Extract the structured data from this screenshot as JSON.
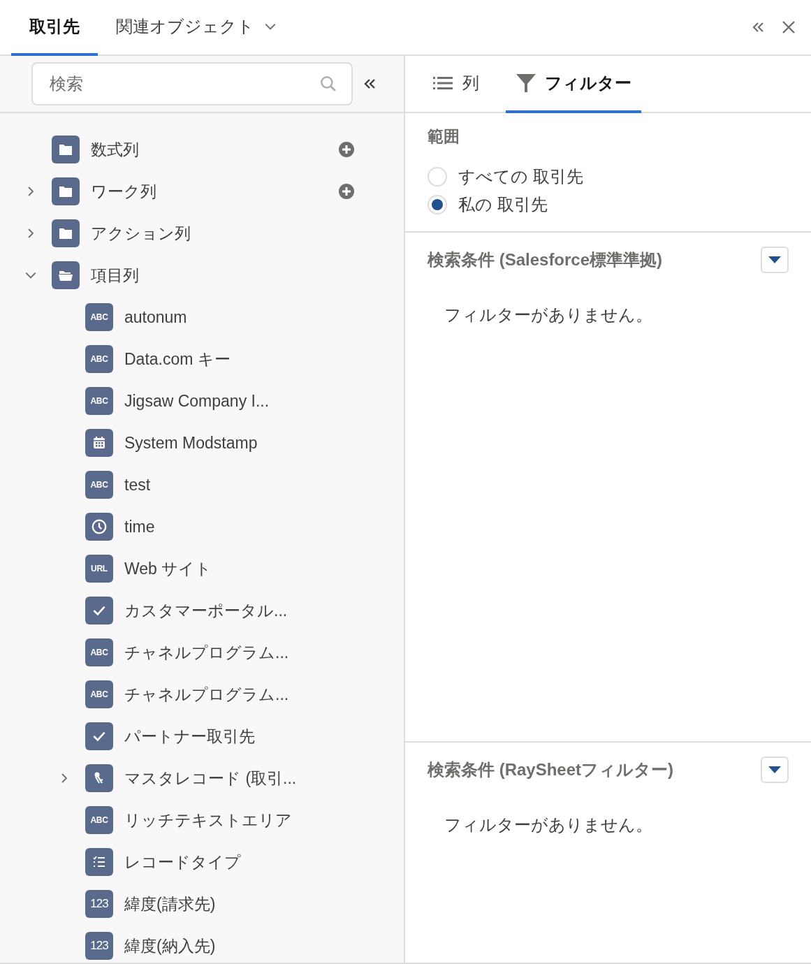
{
  "header": {
    "tabs": [
      {
        "label": "取引先",
        "selected": true,
        "dropdown": false
      },
      {
        "label": "関連オブジェクト",
        "selected": false,
        "dropdown": true
      }
    ]
  },
  "sidebar": {
    "search": {
      "placeholder": "検索"
    },
    "tree": [
      {
        "label": "数式列",
        "kind": "folder",
        "addable": true
      },
      {
        "label": "ワーク列",
        "kind": "folder",
        "addable": true,
        "expanded": false
      },
      {
        "label": "アクション列",
        "kind": "folder",
        "expanded": false
      },
      {
        "label": "項目列",
        "kind": "folder",
        "expanded": true,
        "children": [
          {
            "label": "autonum",
            "kind": "badge",
            "badge": "ABC"
          },
          {
            "label": "Data.com キー",
            "kind": "badge",
            "badge": "ABC"
          },
          {
            "label": "Jigsaw Company I...",
            "kind": "badge",
            "badge": "ABC"
          },
          {
            "label": "System Modstamp",
            "kind": "calendar"
          },
          {
            "label": "test",
            "kind": "badge",
            "badge": "ABC"
          },
          {
            "label": "time",
            "kind": "clock"
          },
          {
            "label": "Web サイト",
            "kind": "badge",
            "badge": "URL"
          },
          {
            "label": "カスタマーポータル...",
            "kind": "check"
          },
          {
            "label": "チャネルプログラム...",
            "kind": "badge",
            "badge": "ABC"
          },
          {
            "label": "チャネルプログラム...",
            "kind": "badge",
            "badge": "ABC"
          },
          {
            "label": "パートナー取引先",
            "kind": "check"
          },
          {
            "label": "マスタレコード (取引...",
            "kind": "key",
            "expanded": false
          },
          {
            "label": "リッチテキストエリア",
            "kind": "badge",
            "badge": "ABC"
          },
          {
            "label": "レコードタイプ",
            "kind": "list"
          },
          {
            "label": "緯度(請求先)",
            "kind": "badge",
            "badge": "123"
          },
          {
            "label": "緯度(納入先)",
            "kind": "badge",
            "badge": "123"
          }
        ]
      }
    ]
  },
  "panel": {
    "tabs": [
      {
        "label": "列",
        "kind": "list",
        "selected": false
      },
      {
        "label": "フィルター",
        "kind": "filter",
        "selected": true
      }
    ],
    "scope": {
      "label": "範囲",
      "options": [
        {
          "label": "すべての 取引先",
          "selected": false
        },
        {
          "label": "私の 取引先",
          "selected": true
        }
      ]
    },
    "sections": [
      {
        "title": "検索条件 (Salesforce標準準拠)",
        "message": "フィルターがありません。"
      },
      {
        "title": "検索条件 (RaySheetフィルター)",
        "message": "フィルターがありません。"
      }
    ]
  }
}
